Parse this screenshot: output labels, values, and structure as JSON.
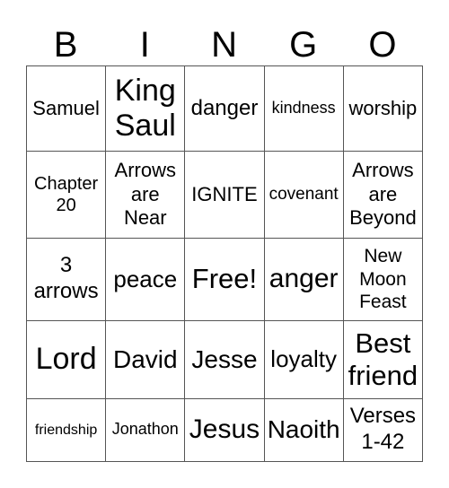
{
  "header": [
    "B",
    "I",
    "N",
    "G",
    "O"
  ],
  "cells": [
    [
      "Samuel",
      "King\nSaul",
      "danger",
      "kindness",
      "worship"
    ],
    [
      "Chapter\n20",
      "Arrows\nare\nNear",
      "IGNITE",
      "covenant",
      "Arrows\nare\nBeyond"
    ],
    [
      "3\narrows",
      "peace",
      "Free!",
      "anger",
      "New\nMoon\nFeast"
    ],
    [
      "Lord",
      "David",
      "Jesse",
      "loyalty",
      "Best\nfriend"
    ],
    [
      "friendship",
      "Jonathon",
      "Jesus",
      "Naoith",
      "Verses\n1-42"
    ]
  ]
}
